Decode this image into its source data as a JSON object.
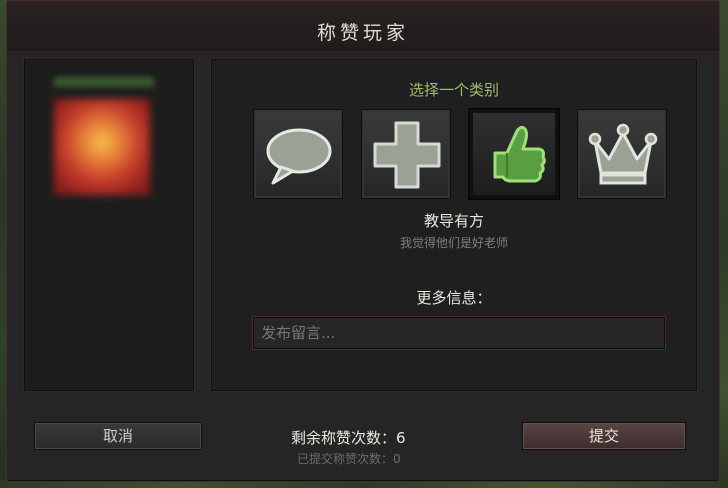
{
  "dialog": {
    "title": "称赞玩家"
  },
  "left_panel": {
    "player_name": "",
    "avatar_icon": "player-avatar-icon"
  },
  "category": {
    "prompt": "选择一个类别",
    "items": [
      {
        "icon": "speech-bubble-icon",
        "selected": false
      },
      {
        "icon": "plus-cross-icon",
        "selected": false
      },
      {
        "icon": "thumbs-up-icon",
        "selected": true
      },
      {
        "icon": "crown-icon",
        "selected": false
      }
    ],
    "selected_title": "教导有方",
    "selected_description": "我觉得他们是好老师"
  },
  "more_info": {
    "label": "更多信息：",
    "placeholder": "发布留言..."
  },
  "footer": {
    "cancel_label": "取消",
    "submit_label": "提交",
    "remaining_label": "剩余称赞次数：",
    "remaining_count": "6",
    "submitted_label": "已提交称赞次数：",
    "submitted_count": "0"
  },
  "colors": {
    "accent_green": "#9bc16b",
    "border_red": "#5b2727",
    "selected_icon": "#6bbf4e"
  }
}
